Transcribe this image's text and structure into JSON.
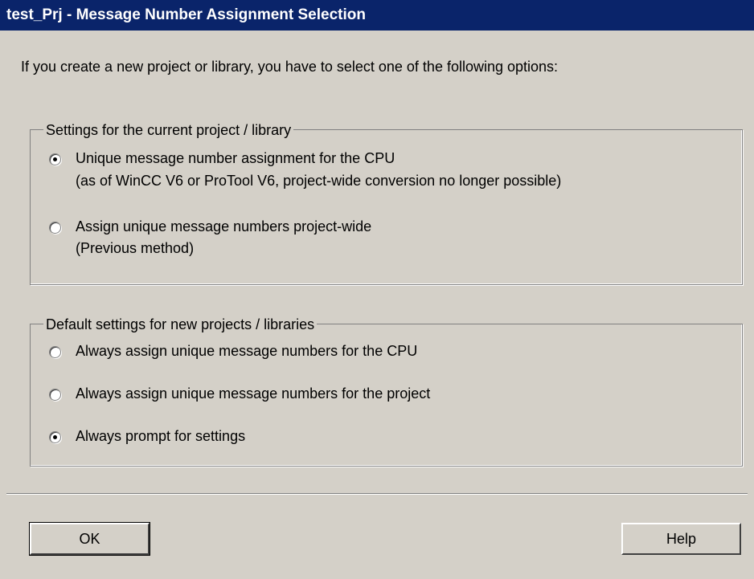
{
  "window": {
    "title": "test_Prj - Message Number Assignment Selection"
  },
  "prompt": "If you create a new project or library, you have to select one of the following options:",
  "current_settings": {
    "legend": "Settings for the current project / library",
    "options": [
      {
        "label_line1": "Unique message number assignment for the CPU",
        "label_line2": "(as of WinCC V6 or ProTool V6, project-wide conversion no longer possible)",
        "selected": true
      },
      {
        "label_line1": "Assign unique message numbers project-wide",
        "label_line2": "(Previous method)",
        "selected": false
      }
    ]
  },
  "default_settings": {
    "legend": "Default settings for new projects / libraries",
    "options": [
      {
        "label": "Always assign unique message numbers for the CPU",
        "selected": false
      },
      {
        "label": "Always assign unique message numbers for the project",
        "selected": false
      },
      {
        "label": "Always prompt for settings",
        "selected": true
      }
    ]
  },
  "buttons": {
    "ok_label": "OK",
    "help_label": "Help"
  }
}
